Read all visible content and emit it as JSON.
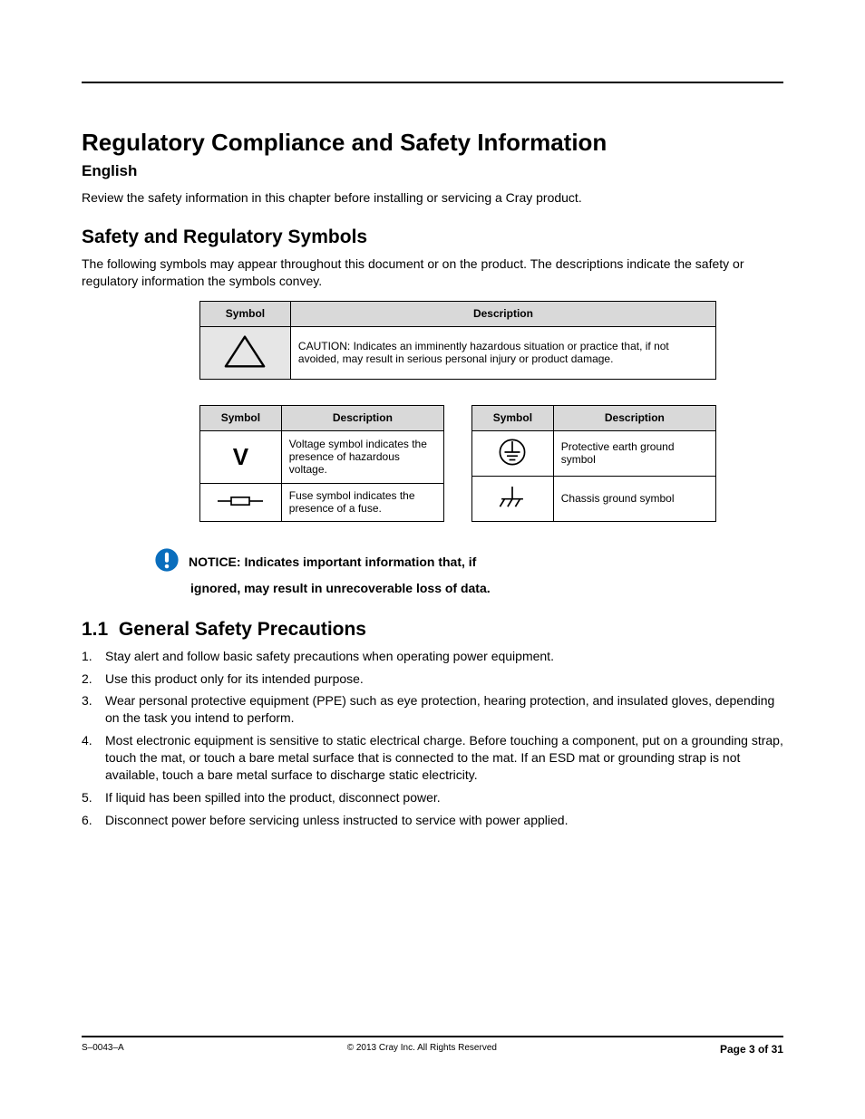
{
  "title": "Regulatory Compliance and Safety Information",
  "language": "English",
  "intro": "Review the safety information in this chapter before installing or servicing a Cray product.",
  "safety": {
    "heading": "Safety and Regulatory Symbols",
    "para": "The following symbols may appear throughout this document or on the product. The descriptions indicate the safety or regulatory information the symbols convey.",
    "tables": {
      "main": {
        "hdr_symbol": "Symbol",
        "hdr_desc": "Description",
        "row1_desc": "CAUTION: Indicates an imminently hazardous situation or practice that, if not avoided, may result in serious personal injury or product damage."
      },
      "left": {
        "hdr_symbol": "Symbol",
        "hdr_desc": "Description",
        "row1_sym": "V",
        "row1_desc": "Voltage symbol indicates the presence of hazardous voltage.",
        "row2_desc": "Fuse symbol indicates the presence of a fuse."
      },
      "right": {
        "hdr_symbol": "Symbol",
        "hdr_desc": "Description",
        "row1_desc": "Protective earth ground symbol",
        "row2_desc": "Chassis ground symbol"
      }
    }
  },
  "notice": {
    "line1": "NOTICE: Indicates important information that, if",
    "line2": "ignored, may result in unrecoverable loss of data."
  },
  "general": {
    "heading_num": "1.1",
    "heading": "General Safety Precautions",
    "bullets": [
      "Stay alert and follow basic safety precautions when operating power equipment.",
      "Use this product only for its intended purpose.",
      "Wear personal protective equipment (PPE) such as eye protection, hearing protection, and insulated gloves, depending on the task you intend to perform.",
      "Most electronic equipment is sensitive to static electrical charge. Before touching a component, put on a grounding strap, touch the mat, or touch a bare metal surface that is connected to the mat. If an ESD mat or grounding strap is not available, touch a bare metal surface to discharge static electricity.",
      "If liquid has been spilled into the product, disconnect power.",
      "Disconnect power before servicing unless instructed to service with power applied."
    ]
  },
  "footer": {
    "left": "S–0043–A",
    "center": "© 2013 Cray Inc. All Rights Reserved",
    "right": "Page 3 of 31"
  }
}
